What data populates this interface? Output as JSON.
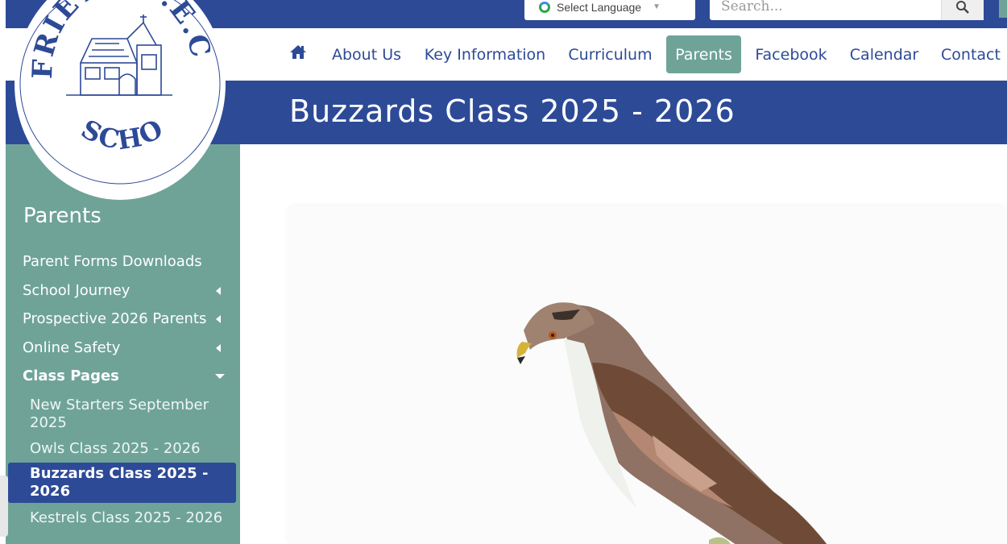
{
  "header": {
    "language_select": "Select Language",
    "search_placeholder": "Search..."
  },
  "nav": {
    "items": [
      "About Us",
      "Key Information",
      "Curriculum",
      "Parents",
      "Facebook",
      "Calendar",
      "Contact"
    ],
    "active": "Parents"
  },
  "page": {
    "title": "Buzzards Class 2025 - 2026"
  },
  "logo": {
    "top_text": "FRIETH C.E.C",
    "bottom_text": "SCHOOL"
  },
  "sidebar": {
    "heading": "Parents",
    "items": [
      {
        "label": "Parent Forms Downloads",
        "has_submenu": false
      },
      {
        "label": "School Journey",
        "has_submenu": true
      },
      {
        "label": "Prospective 2026 Parents",
        "has_submenu": true
      },
      {
        "label": "Online Safety",
        "has_submenu": true
      },
      {
        "label": "Class Pages",
        "expanded": true
      }
    ],
    "sub_items": [
      {
        "label": "New Starters September 2025"
      },
      {
        "label": "Owls Class 2025 - 2026"
      },
      {
        "label": "Buzzards Class 2025 - 2026",
        "active": true
      },
      {
        "label": "Kestrels Class 2025 - 2026"
      }
    ]
  },
  "colors": {
    "primary_blue": "#2d4a97",
    "teal": "#6fa398"
  }
}
